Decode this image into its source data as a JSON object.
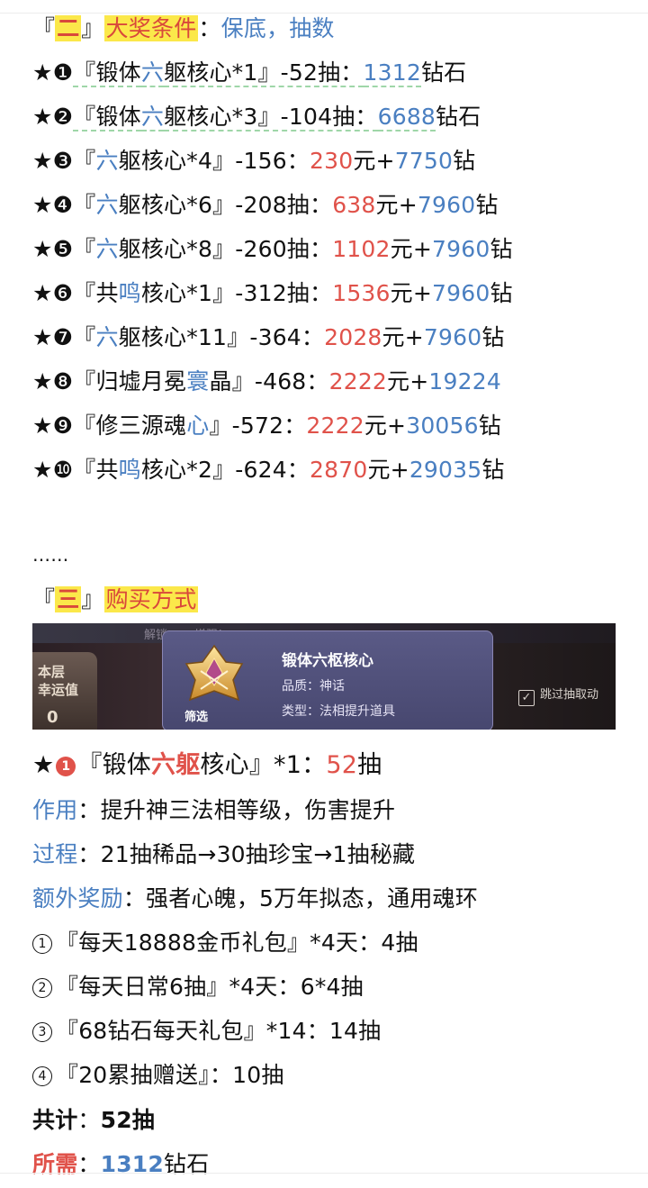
{
  "section2": {
    "open": "『",
    "num": "二",
    "close": "』",
    "title": "大奖条件",
    "colon": "：",
    "subtitle": "保底，抽数"
  },
  "rewards": [
    {
      "mark": "❶",
      "pre": "『锻体",
      "hl": "六",
      "post": "躯核心*1』-52抽：",
      "val1": "1312",
      "mid": "钻石",
      "val2": "",
      "tail": ""
    },
    {
      "mark": "❷",
      "pre": "『锻体",
      "hl": "六",
      "post": "躯核心*3』-104抽：",
      "val1": "6688",
      "mid": "钻石",
      "val2": "",
      "tail": ""
    },
    {
      "mark": "❸",
      "pre": "『",
      "hl": "六",
      "post": "躯核心*4』-156：",
      "val1": "230",
      "mid": "元+",
      "val2": "7750",
      "tail": "钻"
    },
    {
      "mark": "❹",
      "pre": "『",
      "hl": "六",
      "post": "躯核心*6』-208抽：",
      "val1": "638",
      "mid": "元+",
      "val2": "7960",
      "tail": "钻"
    },
    {
      "mark": "❺",
      "pre": "『",
      "hl": "六",
      "post": "躯核心*8』-260抽：",
      "val1": "1102",
      "mid": "元+",
      "val2": "7960",
      "tail": "钻"
    },
    {
      "mark": "❻",
      "pre": "『共",
      "hl": "鸣",
      "post": "核心*1』-312抽：",
      "val1": "1536",
      "mid": "元+",
      "val2": "7960",
      "tail": "钻"
    },
    {
      "mark": "❼",
      "pre": "『",
      "hl": "六",
      "post": "躯核心*11』-364：",
      "val1": "2028",
      "mid": "元+",
      "val2": "7960",
      "tail": "钻"
    },
    {
      "mark": "❽",
      "pre": "『归墟月冕",
      "hl": "寰",
      "post": "晶』-468：",
      "val1": "2222",
      "mid": "元+",
      "val2": "19224",
      "tail": ""
    },
    {
      "mark": "❾",
      "pre": "『修三源魂",
      "hl": "心",
      "post": "』-572：",
      "val1": "2222",
      "mid": "元+",
      "val2": "30056",
      "tail": "钻"
    },
    {
      "mark": "❿",
      "pre": "『共",
      "hl": "鸣",
      "post": "核心*2』-624：",
      "val1": "2870",
      "mid": "元+",
      "val2": "29035",
      "tail": "钻"
    }
  ],
  "ellipsis": "……",
  "section3": {
    "open": "『",
    "num": "三",
    "close": "』",
    "title": "购买方式"
  },
  "banner": {
    "top_text": "解锁…  …增强!",
    "left_label_1": "本层",
    "left_label_2": "幸运值",
    "left_value": "0",
    "card_title": "锻体六枢核心",
    "quality": "品质：神话",
    "type": "类型：法相提升道具",
    "filter_tag": "筛选",
    "skip_label": "跳过抽取动"
  },
  "item1": {
    "star": "★",
    "mark": "1",
    "pre": "『锻体",
    "hl": "六躯",
    "post": "核心』*1：",
    "val": "52",
    "unit": "抽"
  },
  "details": {
    "effect_label": "作用",
    "effect": "：提升神三法相等级，伤害提升",
    "process_label": "过程",
    "process": "：21抽稀品→30抽珍宝→1抽秘藏",
    "bonus_label": "额外奖励",
    "bonus": "：强者心魄，5万年拟态，通用魂环"
  },
  "sources": [
    {
      "mark": "1",
      "text": "『每天18888金币礼包』*4天：4抽"
    },
    {
      "mark": "2",
      "text": "『每天日常6抽』*4天：6*4抽"
    },
    {
      "mark": "3",
      "text": "『68钻石每天礼包』*14：14抽"
    },
    {
      "mark": "4",
      "text": "『20累抽赠送』：10抽"
    }
  ],
  "total": {
    "label": "共计",
    "colon": "：",
    "value": "52抽"
  },
  "required": {
    "label": "所需",
    "colon": "：",
    "value": "1312",
    "unit": "钻石"
  },
  "colors": {
    "blue": "#4a7fc1",
    "red": "#e0524a",
    "highlight": "#fbe84a"
  }
}
